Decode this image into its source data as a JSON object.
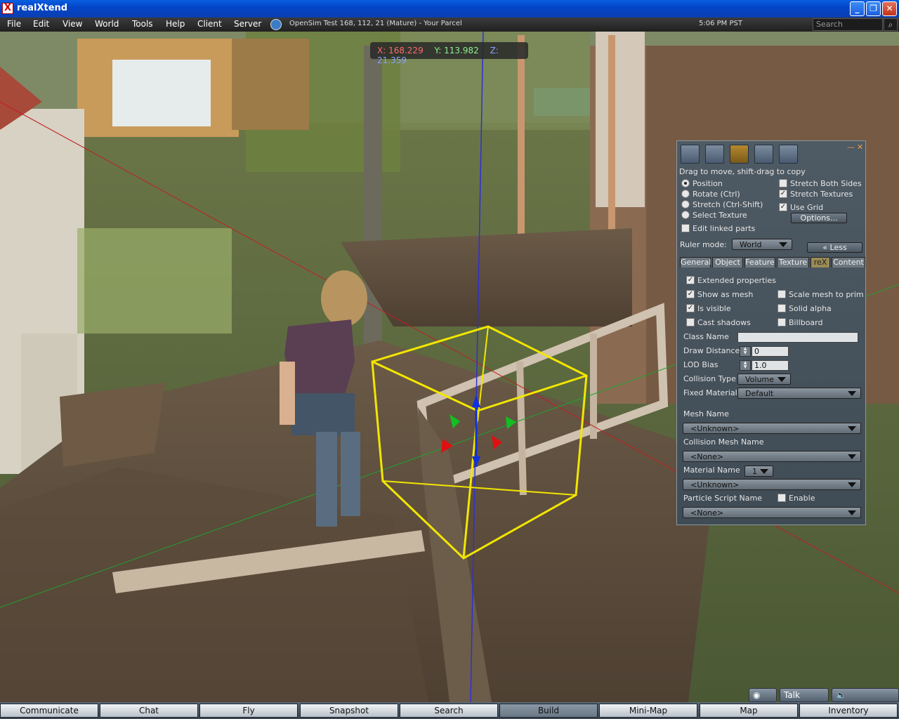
{
  "window": {
    "title": "realXtend",
    "icon": "x-icon"
  },
  "menu": {
    "items": [
      "File",
      "Edit",
      "View",
      "World",
      "Tools",
      "Help",
      "Client",
      "Server"
    ],
    "location": "OpenSim Test 168, 112, 21 (Mature) - Your Parcel",
    "clock": "5:06 PM PST",
    "search_placeholder": "Search"
  },
  "coords": {
    "x": "X: 168.229",
    "y": "Y: 113.982",
    "z": "Z: 21.359"
  },
  "build": {
    "hint": "Drag to move, shift-drag to copy",
    "modes": [
      "Position",
      "Rotate (Ctrl)",
      "Stretch (Ctrl-Shift)",
      "Select Texture"
    ],
    "selected_mode": "Position",
    "edit_linked": "Edit linked parts",
    "stretch_both": "Stretch Both Sides",
    "stretch_textures": "Stretch Textures",
    "use_grid": "Use Grid",
    "options": "Options...",
    "ruler_label": "Ruler mode:",
    "ruler_value": "World",
    "less": "« Less",
    "tabs": [
      "General",
      "Object",
      "Feature",
      "Texture",
      "reX",
      "Content"
    ],
    "selected_tab": "reX",
    "rex": {
      "extended": "Extended properties",
      "show_mesh": "Show as mesh",
      "scale_mesh": "Scale mesh to prim",
      "visible": "Is visible",
      "solid_alpha": "Solid alpha",
      "cast_shadows": "Cast shadows",
      "billboard": "Billboard",
      "class_name_label": "Class Name",
      "class_name": "",
      "draw_distance_label": "Draw Distance",
      "draw_distance": "0",
      "lod_label": "LOD Bias",
      "lod": "1.0",
      "collision_type_label": "Collision Type",
      "collision_type": "Volume",
      "fixed_material_label": "Fixed Material",
      "fixed_material": "Default",
      "mesh_name_label": "Mesh Name",
      "mesh_name": "<Unknown>",
      "collision_mesh_label": "Collision Mesh Name",
      "collision_mesh": "<None>",
      "material_name_label": "Material Name",
      "material_index": "1",
      "material_name": "<Unknown>",
      "particle_label": "Particle Script Name",
      "enable": "Enable",
      "particle": "<None>"
    }
  },
  "voice": {
    "talk": "Talk"
  },
  "bottom": [
    "Communicate",
    "Chat",
    "Fly",
    "Snapshot",
    "Search",
    "Build",
    "Mini-Map",
    "Map",
    "Inventory"
  ],
  "bottom_selected": "Build"
}
